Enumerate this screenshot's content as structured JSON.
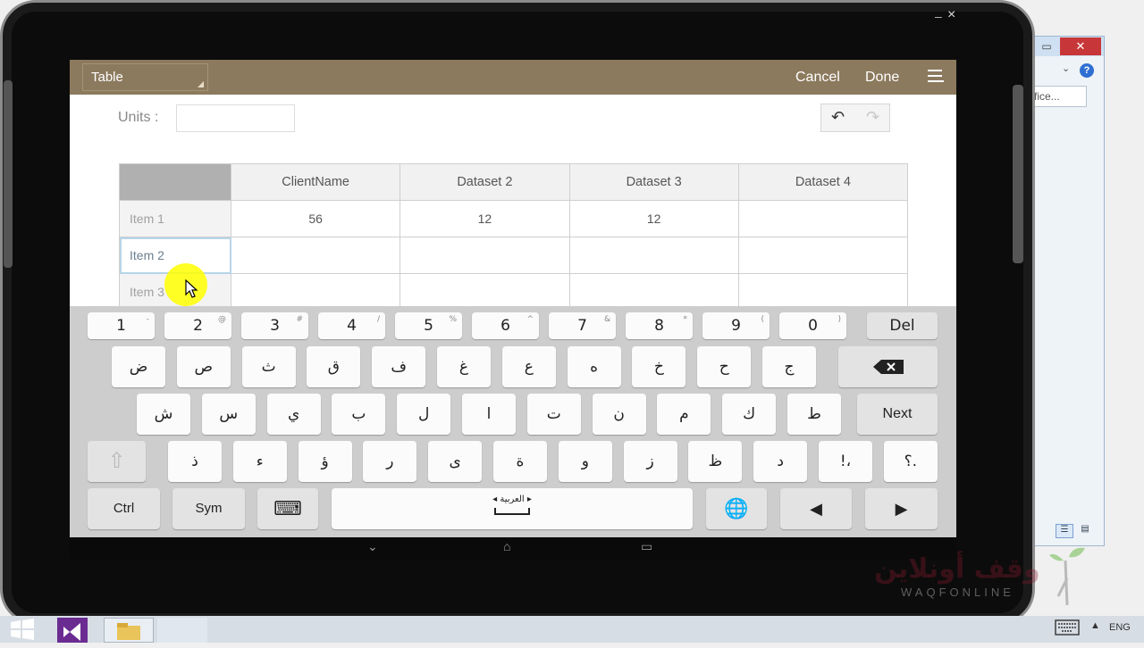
{
  "host_window": {
    "close_label": "✕",
    "min_label": "▭",
    "address_text": "fice...",
    "help_label": "?"
  },
  "emulator": {
    "min_label": "–",
    "close_label": "×"
  },
  "header": {
    "dropdown_label": "Table",
    "cancel_label": "Cancel",
    "done_label": "Done",
    "menu_icon": "hamburger-icon"
  },
  "units": {
    "label": "Units :",
    "value": ""
  },
  "toolbar": {
    "undo_icon": "↶",
    "redo_icon": "↷"
  },
  "table": {
    "columns": [
      "ClientName",
      "Dataset 2",
      "Dataset 3",
      "Dataset 4"
    ],
    "rows": [
      {
        "label": "Item 1",
        "cells": [
          "56",
          "12",
          "12",
          ""
        ]
      },
      {
        "label": "Item 2",
        "cells": [
          "",
          "",
          "",
          ""
        ]
      },
      {
        "label": "Item 3",
        "cells": [
          "",
          "",
          "",
          ""
        ]
      }
    ]
  },
  "keyboard": {
    "number_row": [
      {
        "main": "1",
        "sub": "-"
      },
      {
        "main": "2",
        "sub": "@"
      },
      {
        "main": "3",
        "sub": "#"
      },
      {
        "main": "4",
        "sub": "/"
      },
      {
        "main": "5",
        "sub": "%"
      },
      {
        "main": "6",
        "sub": "^"
      },
      {
        "main": "7",
        "sub": "&"
      },
      {
        "main": "8",
        "sub": "*"
      },
      {
        "main": "9",
        "sub": "("
      },
      {
        "main": "0",
        "sub": ")"
      }
    ],
    "del_label": "Del",
    "row1": [
      "ض",
      "ص",
      "ث",
      "ق",
      "ف",
      "غ",
      "ع",
      "ه",
      "خ",
      "ح",
      "ج"
    ],
    "row2": [
      "ش",
      "س",
      "ي",
      "ب",
      "ل",
      "ا",
      "ت",
      "ن",
      "م",
      "ك",
      "ط"
    ],
    "next_label": "Next",
    "row3": [
      "ذ",
      "ء",
      "ؤ",
      "ر",
      "ى",
      "ة",
      "و",
      "ز",
      "ظ",
      "د",
      "!،",
      "؟."
    ],
    "ctrl_label": "Ctrl",
    "sym_label": "Sym",
    "space_label": "العربية",
    "left_label": "◀",
    "right_label": "▶"
  },
  "watermark": {
    "arabic": "وقف أونلاين",
    "latin": "WAQFONLINE"
  },
  "taskbar": {
    "lang": "ENG",
    "tray_up": "▲"
  }
}
